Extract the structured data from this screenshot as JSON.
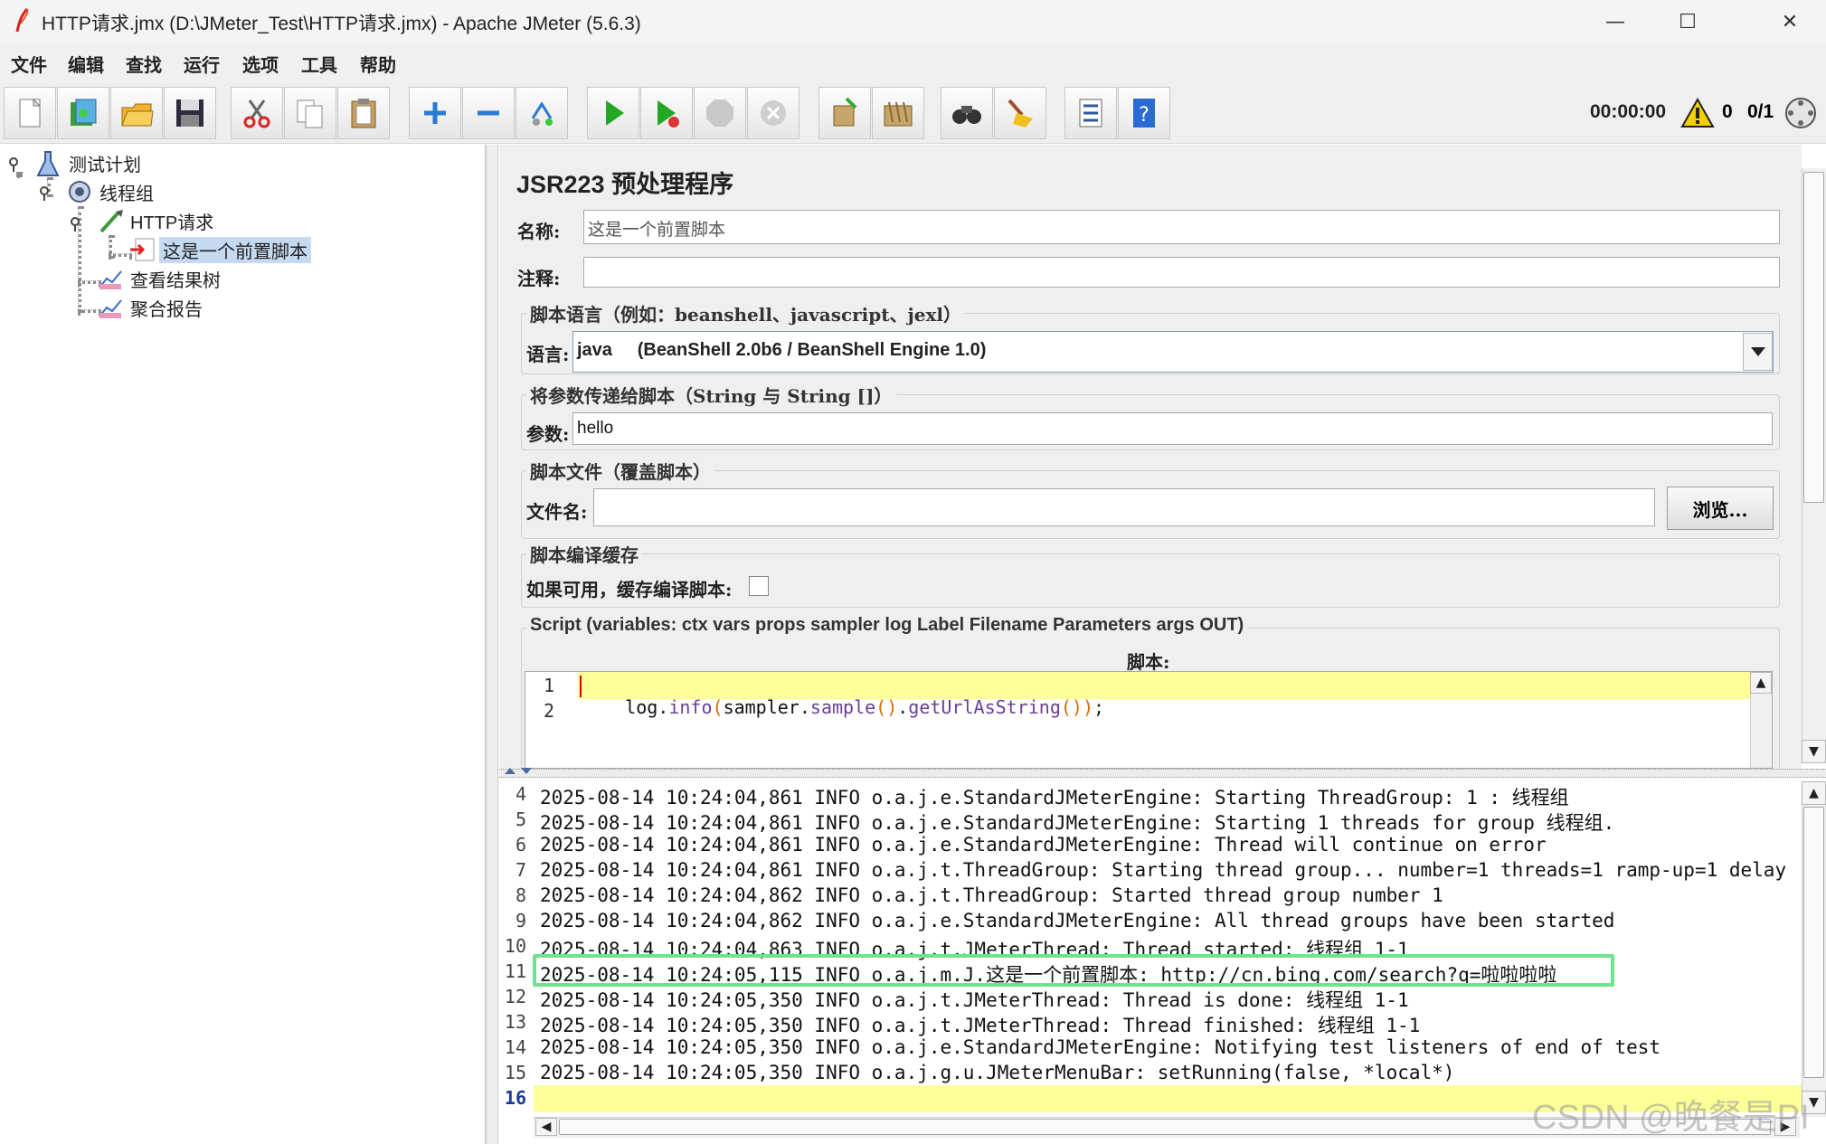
{
  "window": {
    "title": "HTTP请求.jmx (D:\\JMeter_Test\\HTTP请求.jmx) - Apache JMeter (5.6.3)",
    "minimize": "—",
    "maximize": "☐",
    "close": "✕"
  },
  "menu": [
    "文件",
    "编辑",
    "查找",
    "运行",
    "选项",
    "工具",
    "帮助"
  ],
  "toolbar": {
    "timer": "00:00:00",
    "warning_count": "0",
    "threads": "0/1",
    "buttons": [
      "new-icon",
      "templates-icon",
      "open-icon",
      "save-icon",
      "cut-icon",
      "copy-icon",
      "paste-icon",
      "expand-icon",
      "collapse-icon",
      "toggle-icon",
      "start-icon",
      "start-no-pause-icon",
      "stop-icon",
      "shutdown-icon",
      "clear-icon",
      "clear-all-icon",
      "search-icon",
      "reset-search-icon",
      "function-helper-icon",
      "help-icon"
    ]
  },
  "tree": {
    "items": [
      {
        "label": "测试计划"
      },
      {
        "label": "线程组"
      },
      {
        "label": "HTTP请求"
      },
      {
        "label": "这是一个前置脚本"
      },
      {
        "label": "查看结果树"
      },
      {
        "label": "聚合报告"
      }
    ]
  },
  "config": {
    "heading": "JSR223 预处理程序",
    "name_label": "名称:",
    "name_value": "这是一个前置脚本",
    "comment_label": "注释:",
    "comment_value": "",
    "lang_group": "脚本语言（例如：beanshell、javascript、jexl）",
    "lang_label": "语言:",
    "lang_value": "java     (BeanShell 2.0b6 / BeanShell Engine 1.0)",
    "params_group": "将参数传递给脚本（String 与 String []）",
    "params_label": "参数:",
    "params_value": "hello",
    "file_group": "脚本文件（覆盖脚本）",
    "file_label": "文件名:",
    "file_value": "",
    "browse_label": "浏览...",
    "cache_group": "脚本编译缓存",
    "cache_label": "如果可用，缓存编译脚本:",
    "script_group": "Script (variables: ctx vars props sampler log Label Filename Parameters args OUT)",
    "script_label": "脚本:"
  },
  "editor": {
    "lines": [
      {
        "num": "1",
        "code": "log.info(sampler.sample().getUrlAsString());"
      },
      {
        "num": "2",
        "code": ""
      }
    ]
  },
  "log": {
    "lines": [
      {
        "num": "4",
        "text": "2025-08-14 10:24:04,861 INFO o.a.j.e.StandardJMeterEngine: Starting ThreadGroup: 1 : 线程组"
      },
      {
        "num": "5",
        "text": "2025-08-14 10:24:04,861 INFO o.a.j.e.StandardJMeterEngine: Starting 1 threads for group 线程组."
      },
      {
        "num": "6",
        "text": "2025-08-14 10:24:04,861 INFO o.a.j.e.StandardJMeterEngine: Thread will continue on error"
      },
      {
        "num": "7",
        "text": "2025-08-14 10:24:04,861 INFO o.a.j.t.ThreadGroup: Starting thread group... number=1 threads=1 ramp-up=1 delay"
      },
      {
        "num": "8",
        "text": "2025-08-14 10:24:04,862 INFO o.a.j.t.ThreadGroup: Started thread group number 1"
      },
      {
        "num": "9",
        "text": "2025-08-14 10:24:04,862 INFO o.a.j.e.StandardJMeterEngine: All thread groups have been started"
      },
      {
        "num": "10",
        "text": "2025-08-14 10:24:04,863 INFO o.a.j.t.JMeterThread: Thread started: 线程组 1-1"
      },
      {
        "num": "11",
        "text": "2025-08-14 10:24:05,115 INFO o.a.j.m.J.这是一个前置脚本: ",
        "link": "http://cn.bing.com/search?q=啦啦啦啦"
      },
      {
        "num": "12",
        "text": "2025-08-14 10:24:05,350 INFO o.a.j.t.JMeterThread: Thread is done: 线程组 1-1"
      },
      {
        "num": "13",
        "text": "2025-08-14 10:24:05,350 INFO o.a.j.t.JMeterThread: Thread finished: 线程组 1-1"
      },
      {
        "num": "14",
        "text": "2025-08-14 10:24:05,350 INFO o.a.j.e.StandardJMeterEngine: Notifying test listeners of end of test"
      },
      {
        "num": "15",
        "text": "2025-08-14 10:24:05,350 INFO o.a.j.g.u.JMeterMenuBar: setRunning(false, *local*)"
      },
      {
        "num": "16",
        "text": ""
      }
    ]
  },
  "watermark": "CSDN @晚餐是PI",
  "colors": {
    "highlight": "#6fe28d",
    "current_line": "#ffff99",
    "selection": "#c5d9f1"
  }
}
